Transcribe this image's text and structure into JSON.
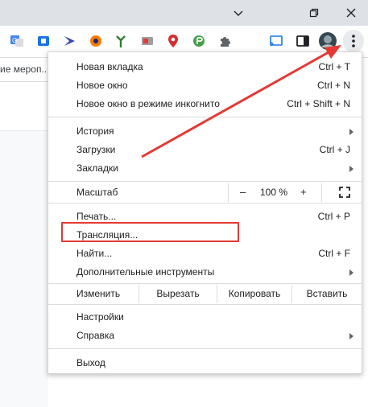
{
  "window": {
    "minimize_icon": "minimize-icon",
    "restore_icon": "restore-icon",
    "close_icon": "close-icon"
  },
  "toolbar": {
    "extensions": [
      "translate-icon",
      "extension-icon",
      "extension-icon",
      "extension-icon",
      "extension-icon",
      "extension-icon",
      "extension-icon",
      "extension-icon",
      "puzzle-icon",
      "cast-icon",
      "side-panel-icon"
    ],
    "menu_icon": "more-vert-icon"
  },
  "bookmarks": {
    "item_text": "ие мероп..."
  },
  "menu": {
    "new_tab": {
      "label": "Новая вкладка",
      "shortcut": "Ctrl + T"
    },
    "new_window": {
      "label": "Новое окно",
      "shortcut": "Ctrl + N"
    },
    "incognito": {
      "label": "Новое окно в режиме инкогнито",
      "shortcut": "Ctrl + Shift + N"
    },
    "history": {
      "label": "История"
    },
    "downloads": {
      "label": "Загрузки",
      "shortcut": "Ctrl + J"
    },
    "bookmarks": {
      "label": "Закладки"
    },
    "zoom": {
      "label": "Масштаб",
      "minus": "–",
      "value": "100 %",
      "plus": "+"
    },
    "print": {
      "label": "Печать...",
      "shortcut": "Ctrl + P"
    },
    "cast": {
      "label": "Трансляция..."
    },
    "find": {
      "label": "Найти...",
      "shortcut": "Ctrl + F"
    },
    "more_tools": {
      "label": "Дополнительные инструменты"
    },
    "edit": {
      "label": "Изменить",
      "cut": "Вырезать",
      "copy": "Копировать",
      "paste": "Вставить"
    },
    "settings": {
      "label": "Настройки"
    },
    "help": {
      "label": "Справка"
    },
    "exit": {
      "label": "Выход"
    }
  },
  "annotation": {
    "color": "#e53935"
  }
}
